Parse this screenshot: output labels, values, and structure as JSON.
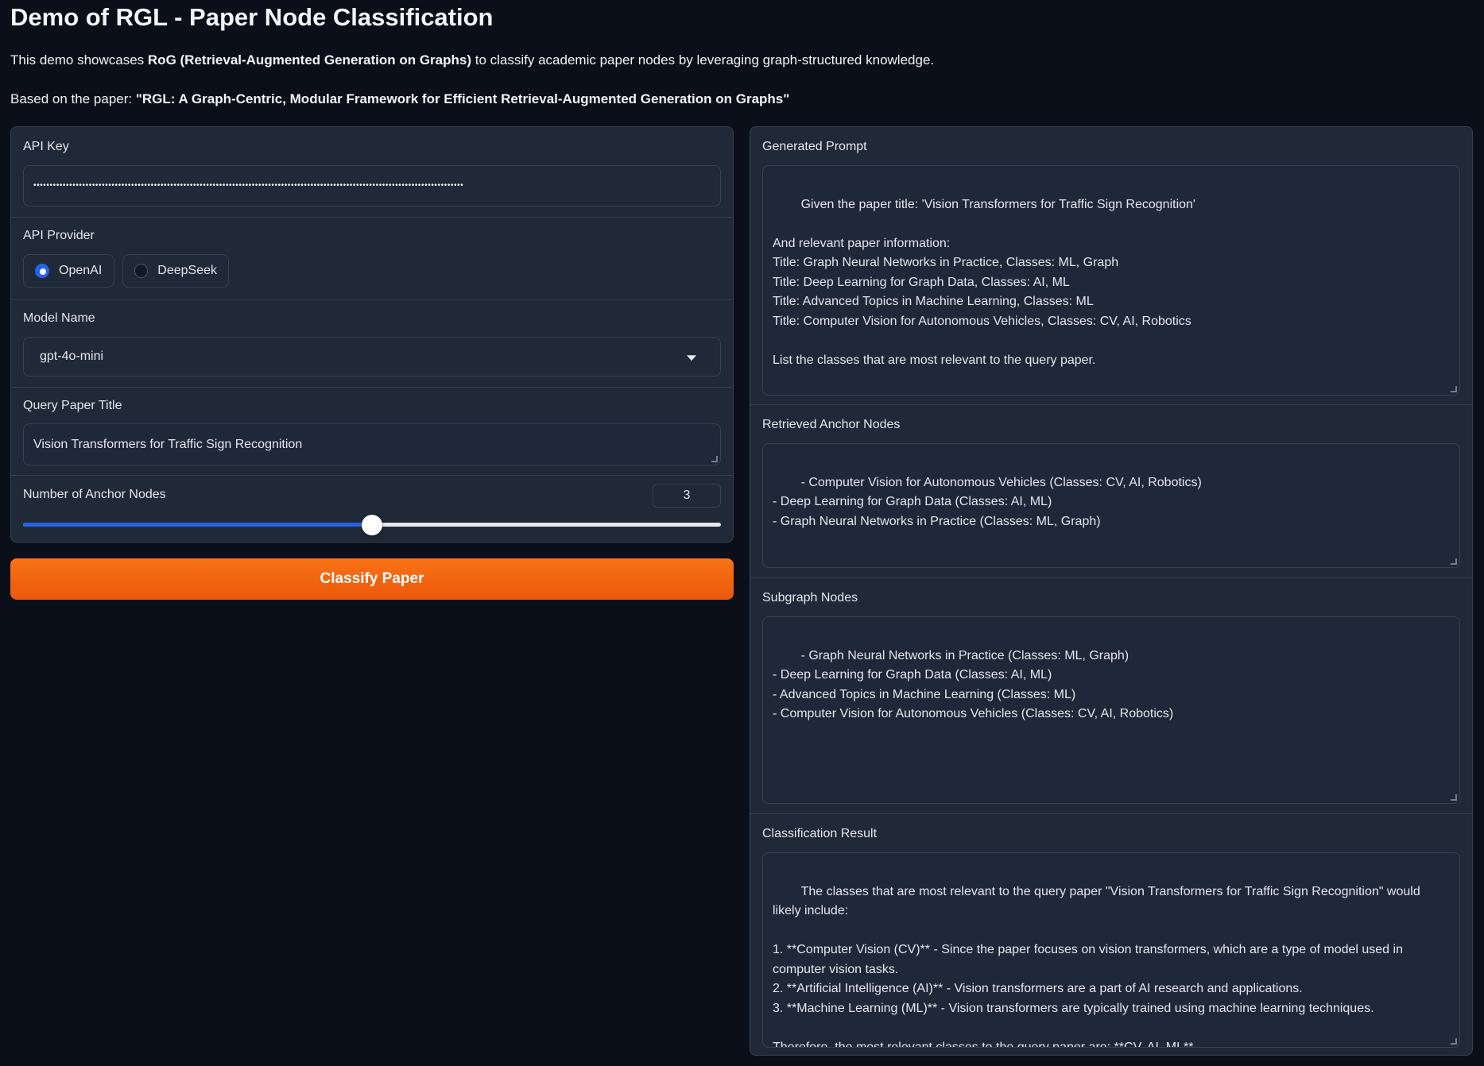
{
  "header": {
    "title": "Demo of RGL - Paper Node Classification",
    "desc_prefix": "This demo showcases ",
    "desc_bold": "RoG (Retrieval-Augmented Generation on Graphs)",
    "desc_suffix": " to classify academic paper nodes by leveraging graph-structured knowledge.",
    "paper_prefix": "Based on the paper: ",
    "paper_bold": "\"RGL: A Graph-Centric, Modular Framework for Efficient Retrieval-Augmented Generation on Graphs\""
  },
  "inputs": {
    "api_key": {
      "label": "API Key",
      "masked_value": "••••••••••••••••••••••••••••••••••••••••••••••••••••••••••••••••••••••••••••••••••••••••••••••••••••••••••••••••••••••••••••••••••••"
    },
    "provider": {
      "label": "API Provider",
      "options": [
        "OpenAI",
        "DeepSeek"
      ],
      "selected": "OpenAI"
    },
    "model": {
      "label": "Model Name",
      "value": "gpt-4o-mini"
    },
    "query_title": {
      "label": "Query Paper Title",
      "value": "Vision Transformers for Traffic Sign Recognition"
    },
    "anchor_nodes": {
      "label": "Number of Anchor Nodes",
      "value": "3",
      "slider_fraction": 0.5
    }
  },
  "classify_button": "Classify Paper",
  "outputs": {
    "generated_prompt": {
      "label": "Generated Prompt",
      "text": "Given the paper title: 'Vision Transformers for Traffic Sign Recognition'\n\nAnd relevant paper information:\nTitle: Graph Neural Networks in Practice, Classes: ML, Graph\nTitle: Deep Learning for Graph Data, Classes: AI, ML\nTitle: Advanced Topics in Machine Learning, Classes: ML\nTitle: Computer Vision for Autonomous Vehicles, Classes: CV, AI, Robotics\n\nList the classes that are most relevant to the query paper."
    },
    "anchor_nodes": {
      "label": "Retrieved Anchor Nodes",
      "text": "- Computer Vision for Autonomous Vehicles (Classes: CV, AI, Robotics)\n- Deep Learning for Graph Data (Classes: AI, ML)\n- Graph Neural Networks in Practice (Classes: ML, Graph)"
    },
    "subgraph_nodes": {
      "label": "Subgraph Nodes",
      "text": "- Graph Neural Networks in Practice (Classes: ML, Graph)\n- Deep Learning for Graph Data (Classes: AI, ML)\n- Advanced Topics in Machine Learning (Classes: ML)\n- Computer Vision for Autonomous Vehicles (Classes: CV, AI, Robotics)"
    },
    "classification": {
      "label": "Classification Result",
      "text": "The classes that are most relevant to the query paper \"Vision Transformers for Traffic Sign Recognition\" would likely include:\n\n1. **Computer Vision (CV)** - Since the paper focuses on vision transformers, which are a type of model used in computer vision tasks.\n2. **Artificial Intelligence (AI)** - Vision transformers are a part of AI research and applications.\n3. **Machine Learning (ML)** - Vision transformers are typically trained using machine learning techniques.\n\nTherefore, the most relevant classes to the query paper are: **CV, AI, ML**."
    }
  },
  "colors": {
    "background": "#0b0f19",
    "panel": "#1f2937",
    "accent": "#2563eb",
    "button": "#f97316"
  }
}
